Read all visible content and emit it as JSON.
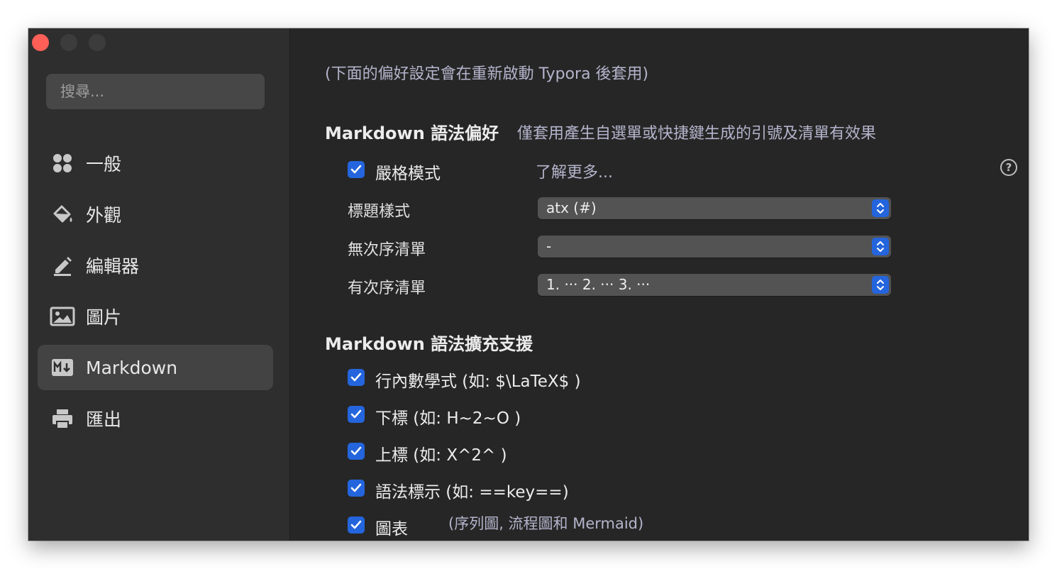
{
  "sidebar": {
    "search_placeholder": "搜尋...",
    "items": [
      {
        "label": "一般",
        "icon": "grid-icon"
      },
      {
        "label": "外觀",
        "icon": "paint-bucket-icon"
      },
      {
        "label": "編輯器",
        "icon": "pencil-icon"
      },
      {
        "label": "圖片",
        "icon": "image-icon"
      },
      {
        "label": "Markdown",
        "icon": "markdown-icon",
        "active": true
      },
      {
        "label": "匯出",
        "icon": "printer-icon"
      }
    ]
  },
  "main": {
    "restart_note": "(下面的偏好設定會在重新啟動 Typora 後套用)",
    "syntax_prefs": {
      "title": "Markdown 語法偏好",
      "hint": "僅套用產生自選單或快捷鍵生成的引號及清單有效果",
      "strict_mode": {
        "label": "嚴格模式",
        "checked": true
      },
      "learn_more": "了解更多...",
      "help_symbol": "?",
      "heading_style": {
        "label": "標題樣式",
        "value": "atx (#)"
      },
      "unordered_list": {
        "label": "無次序清單",
        "value": "-"
      },
      "ordered_list": {
        "label": "有次序清單",
        "value": "1. ··· 2. ··· 3. ···"
      }
    },
    "syntax_ext": {
      "title": "Markdown 語法擴充支援",
      "items": [
        {
          "label": "行內數學式 (如: $\\LaTeX$ )",
          "checked": true
        },
        {
          "label": "下標 (如: H~2~O )",
          "checked": true
        },
        {
          "label": "上標 (如: X^2^ )",
          "checked": true
        },
        {
          "label": "語法標示 (如: ==key==)",
          "checked": true
        },
        {
          "label": "圖表",
          "checked": true,
          "note": "(序列圖, 流程圖和 Mermaid)"
        }
      ]
    }
  },
  "colors": {
    "accent": "#2465dd",
    "close_button": "#fe5f57",
    "window_bg": "#262626",
    "sidebar_bg": "#2e2e2e"
  }
}
